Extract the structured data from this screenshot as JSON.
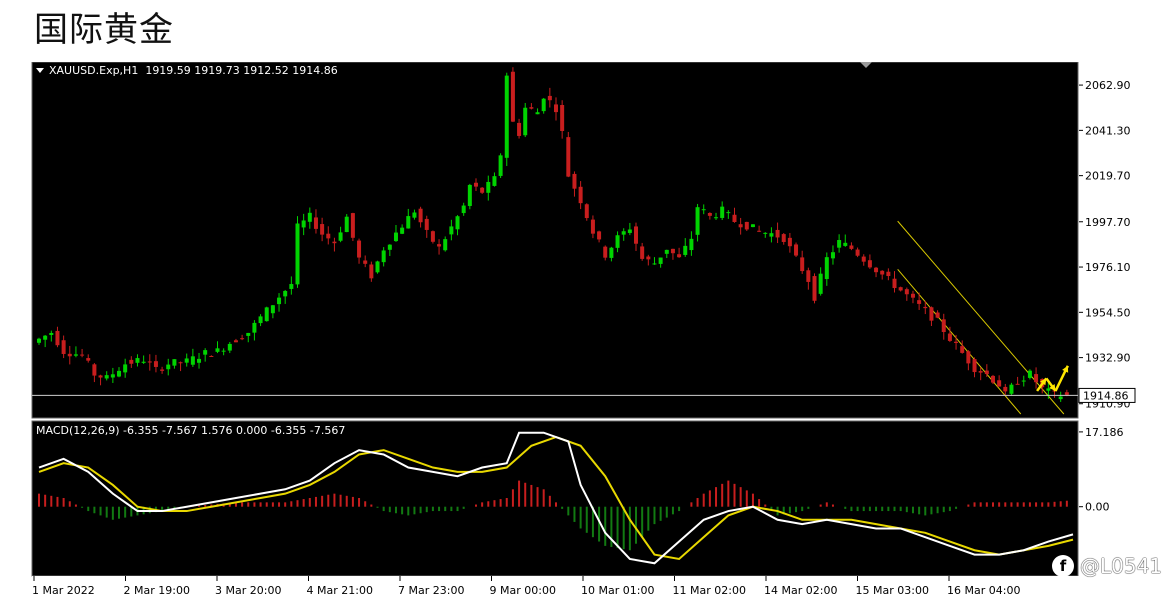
{
  "page": {
    "title": "国际黄金"
  },
  "chart_data": {
    "type": "candlestick",
    "symbol_header": "XAUUSD.Exp,H1  1919.59 1919.73 1912.52 1914.86",
    "symbol": "XAUUSD.Exp",
    "timeframe": "H1",
    "ohlc": {
      "open": 1919.59,
      "high": 1919.73,
      "low": 1912.52,
      "close": 1914.86
    },
    "price_ticks": [
      "2062.90",
      "2041.30",
      "2019.70",
      "1997.70",
      "1976.10",
      "1954.50",
      "1932.90",
      "1910.90"
    ],
    "current_price_label": "1914.86",
    "current_price": 1914.86,
    "ylim": [
      1906,
      2072
    ],
    "x_ticks": [
      "1 Mar 2022",
      "2 Mar 19:00",
      "3 Mar 20:00",
      "4 Mar 21:00",
      "7 Mar 23:00",
      "9 Mar 00:00",
      "10 Mar 01:00",
      "11 Mar 02:00",
      "14 Mar 02:00",
      "15 Mar 03:00",
      "16 Mar 04:00"
    ],
    "price_path": [
      [
        0,
        1940
      ],
      [
        3,
        1945
      ],
      [
        5,
        1936
      ],
      [
        8,
        1934
      ],
      [
        10,
        1925
      ],
      [
        12,
        1923
      ],
      [
        15,
        1930
      ],
      [
        18,
        1932
      ],
      [
        20,
        1927
      ],
      [
        22,
        1930
      ],
      [
        25,
        1931
      ],
      [
        28,
        1935
      ],
      [
        30,
        1936
      ],
      [
        32,
        1940
      ],
      [
        35,
        1945
      ],
      [
        37,
        1952
      ],
      [
        40,
        1962
      ],
      [
        42,
        1968
      ],
      [
        43,
        1995
      ],
      [
        45,
        2000
      ],
      [
        47,
        1992
      ],
      [
        49,
        1988
      ],
      [
        51,
        2000
      ],
      [
        53,
        1980
      ],
      [
        55,
        1972
      ],
      [
        57,
        1985
      ],
      [
        60,
        1996
      ],
      [
        62,
        2003
      ],
      [
        64,
        1992
      ],
      [
        66,
        1985
      ],
      [
        68,
        1995
      ],
      [
        70,
        2005
      ],
      [
        71,
        2015
      ],
      [
        73,
        2012
      ],
      [
        75,
        2018
      ],
      [
        76,
        2030
      ],
      [
        77,
        2068
      ],
      [
        78,
        2045
      ],
      [
        79,
        2040
      ],
      [
        80,
        2052
      ],
      [
        82,
        2050
      ],
      [
        83,
        2058
      ],
      [
        85,
        2052
      ],
      [
        86,
        2040
      ],
      [
        87,
        2020
      ],
      [
        89,
        2008
      ],
      [
        91,
        1993
      ],
      [
        93,
        1982
      ],
      [
        95,
        1990
      ],
      [
        97,
        1995
      ],
      [
        99,
        1980
      ],
      [
        101,
        1978
      ],
      [
        103,
        1985
      ],
      [
        105,
        1980
      ],
      [
        107,
        1990
      ],
      [
        108,
        2005
      ],
      [
        110,
        2000
      ],
      [
        112,
        2003
      ],
      [
        114,
        1998
      ],
      [
        116,
        1996
      ],
      [
        118,
        1993
      ],
      [
        120,
        1992
      ],
      [
        122,
        1990
      ],
      [
        124,
        1980
      ],
      [
        126,
        1970
      ],
      [
        127,
        1962
      ],
      [
        129,
        1980
      ],
      [
        131,
        1988
      ],
      [
        133,
        1985
      ],
      [
        135,
        1980
      ],
      [
        137,
        1975
      ],
      [
        139,
        1970
      ],
      [
        141,
        1965
      ],
      [
        143,
        1960
      ],
      [
        145,
        1955
      ],
      [
        147,
        1950
      ],
      [
        149,
        1942
      ],
      [
        151,
        1935
      ],
      [
        153,
        1928
      ],
      [
        155,
        1925
      ],
      [
        157,
        1920
      ],
      [
        158,
        1915
      ],
      [
        160,
        1922
      ],
      [
        162,
        1925
      ],
      [
        164,
        1918
      ],
      [
        166,
        1915
      ],
      [
        168,
        1914.86
      ]
    ],
    "macd": {
      "header": "MACD(12,26,9) -6.355 -7.567 1.576 0.000 -6.355 -7.567",
      "params": [
        12,
        26,
        9
      ],
      "main": -6.355,
      "signal": -7.567,
      "y_ticks": [
        "17.186",
        "0.00"
      ],
      "ylim": [
        -15,
        19
      ],
      "macd_line": [
        [
          0,
          9
        ],
        [
          4,
          11
        ],
        [
          8,
          8
        ],
        [
          12,
          3
        ],
        [
          16,
          -1
        ],
        [
          20,
          -1
        ],
        [
          24,
          0
        ],
        [
          28,
          1
        ],
        [
          32,
          2
        ],
        [
          36,
          3
        ],
        [
          40,
          4
        ],
        [
          44,
          6
        ],
        [
          48,
          10
        ],
        [
          52,
          13
        ],
        [
          56,
          12
        ],
        [
          60,
          9
        ],
        [
          64,
          8
        ],
        [
          68,
          7
        ],
        [
          72,
          9
        ],
        [
          76,
          10
        ],
        [
          78,
          17
        ],
        [
          82,
          17
        ],
        [
          86,
          15
        ],
        [
          88,
          5
        ],
        [
          92,
          -6
        ],
        [
          96,
          -12
        ],
        [
          100,
          -13
        ],
        [
          104,
          -8
        ],
        [
          108,
          -3
        ],
        [
          112,
          -1
        ],
        [
          116,
          0
        ],
        [
          120,
          -3
        ],
        [
          124,
          -4
        ],
        [
          128,
          -3
        ],
        [
          132,
          -4
        ],
        [
          136,
          -5
        ],
        [
          140,
          -5
        ],
        [
          144,
          -7
        ],
        [
          148,
          -9
        ],
        [
          152,
          -11
        ],
        [
          156,
          -11
        ],
        [
          160,
          -10
        ],
        [
          164,
          -8
        ],
        [
          168,
          -6.355
        ]
      ],
      "signal_line": [
        [
          0,
          8
        ],
        [
          4,
          10
        ],
        [
          8,
          9
        ],
        [
          12,
          5
        ],
        [
          16,
          0
        ],
        [
          20,
          -1
        ],
        [
          24,
          -1
        ],
        [
          28,
          0
        ],
        [
          32,
          1
        ],
        [
          36,
          2
        ],
        [
          40,
          3
        ],
        [
          44,
          5
        ],
        [
          48,
          8
        ],
        [
          52,
          12
        ],
        [
          56,
          13
        ],
        [
          60,
          11
        ],
        [
          64,
          9
        ],
        [
          68,
          8
        ],
        [
          72,
          8
        ],
        [
          76,
          9
        ],
        [
          80,
          14
        ],
        [
          84,
          16
        ],
        [
          88,
          14
        ],
        [
          92,
          7
        ],
        [
          96,
          -3
        ],
        [
          100,
          -11
        ],
        [
          104,
          -12
        ],
        [
          108,
          -7
        ],
        [
          112,
          -2
        ],
        [
          116,
          0
        ],
        [
          120,
          -1
        ],
        [
          124,
          -3
        ],
        [
          128,
          -3
        ],
        [
          132,
          -3
        ],
        [
          136,
          -4
        ],
        [
          140,
          -5
        ],
        [
          144,
          -6
        ],
        [
          148,
          -8
        ],
        [
          152,
          -10
        ],
        [
          156,
          -11
        ],
        [
          160,
          -10
        ],
        [
          164,
          -9
        ],
        [
          168,
          -7.567
        ]
      ],
      "histogram": [
        [
          0,
          3
        ],
        [
          4,
          2
        ],
        [
          8,
          -1
        ],
        [
          12,
          -3
        ],
        [
          16,
          -2
        ],
        [
          20,
          -1
        ],
        [
          24,
          0
        ],
        [
          28,
          0.5
        ],
        [
          32,
          1
        ],
        [
          36,
          1
        ],
        [
          40,
          1
        ],
        [
          44,
          2
        ],
        [
          48,
          3
        ],
        [
          52,
          2
        ],
        [
          56,
          -1
        ],
        [
          60,
          -2
        ],
        [
          64,
          -1
        ],
        [
          68,
          -1
        ],
        [
          72,
          1
        ],
        [
          76,
          2
        ],
        [
          78,
          6
        ],
        [
          82,
          4
        ],
        [
          86,
          -2
        ],
        [
          88,
          -5
        ],
        [
          92,
          -9
        ],
        [
          96,
          -10
        ],
        [
          100,
          -4
        ],
        [
          104,
          -1
        ],
        [
          108,
          3
        ],
        [
          112,
          6
        ],
        [
          116,
          3
        ],
        [
          120,
          -2
        ],
        [
          124,
          -1
        ],
        [
          128,
          1
        ],
        [
          132,
          -1
        ],
        [
          136,
          -1
        ],
        [
          140,
          -1
        ],
        [
          144,
          -2
        ],
        [
          148,
          -1
        ],
        [
          152,
          1
        ],
        [
          156,
          1
        ],
        [
          160,
          1
        ],
        [
          164,
          1
        ],
        [
          168,
          1.5
        ]
      ]
    },
    "annotations": {
      "channel": "descending channel (yellow lines)",
      "projection": "yellow zig-zag arrows pointing up"
    },
    "colors": {
      "bull": "#00d400",
      "bear": "#c81e1e",
      "background": "#000000",
      "macd_line": "#ffffff",
      "signal_line": "#e8d800",
      "channel": "#d8c800",
      "hist_pos": "#c81e1e",
      "hist_neg": "#127a12",
      "current_line": "#cfcfcf"
    }
  },
  "watermark": {
    "icon": "f-logo-icon",
    "text": "@L0541"
  }
}
